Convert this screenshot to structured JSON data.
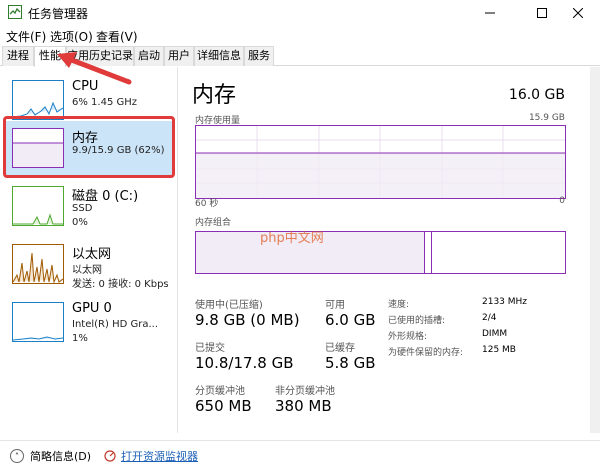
{
  "window": {
    "title": "任务管理器",
    "accent": "#8b2eb6",
    "cpu_color": "#1b7fc8",
    "disk_color": "#4ea72e",
    "net_color": "#a05a00"
  },
  "menu": [
    "文件(F)",
    "选项(O)",
    "查看(V)"
  ],
  "tabs": [
    "进程",
    "性能",
    "应用历史记录",
    "启动",
    "用户",
    "详细信息",
    "服务"
  ],
  "active_tab": "性能",
  "sidebar": [
    {
      "name": "CPU",
      "line1": "6%  1.45 GHz",
      "line2": ""
    },
    {
      "name": "内存",
      "line1": "9.9/15.9 GB (62%)",
      "line2": ""
    },
    {
      "name": "磁盘 0 (C:)",
      "line1": "SSD",
      "line2": "0%"
    },
    {
      "name": "以太网",
      "line1": "以太网",
      "line2": "发送: 0  接收: 0 Kbps"
    },
    {
      "name": "GPU 0",
      "line1": "Intel(R) HD Gra...",
      "line2": "1%"
    }
  ],
  "memory": {
    "title": "内存",
    "total": "16.0 GB",
    "usage_label": "内存使用量",
    "usage_max": "15.9 GB",
    "time_left": "60 秒",
    "time_right": "0",
    "composition_label": "内存组合",
    "composition_used_fraction": 0.62,
    "composition_modified_fraction": 0.64
  },
  "stats": {
    "in_use_label": "使用中(已压缩)",
    "in_use_value": "9.8 GB (0 MB)",
    "available_label": "可用",
    "available_value": "6.0 GB",
    "committed_label": "已提交",
    "committed_value": "10.8/17.8 GB",
    "cached_label": "已缓存",
    "cached_value": "5.8 GB",
    "paged_label": "分页缓冲池",
    "paged_value": "650 MB",
    "nonpaged_label": "非分页缓冲池",
    "nonpaged_value": "380 MB"
  },
  "details": [
    {
      "key": "速度:",
      "value": "2133 MHz"
    },
    {
      "key": "已使用的插槽:",
      "value": "2/4"
    },
    {
      "key": "外形规格:",
      "value": "DIMM"
    },
    {
      "key": "为硬件保留的内存:",
      "value": "125 MB"
    }
  ],
  "watermark": "php中文网",
  "footer": {
    "fewer_details": "简略信息(D)",
    "open_monitor": "打开资源监视器"
  }
}
